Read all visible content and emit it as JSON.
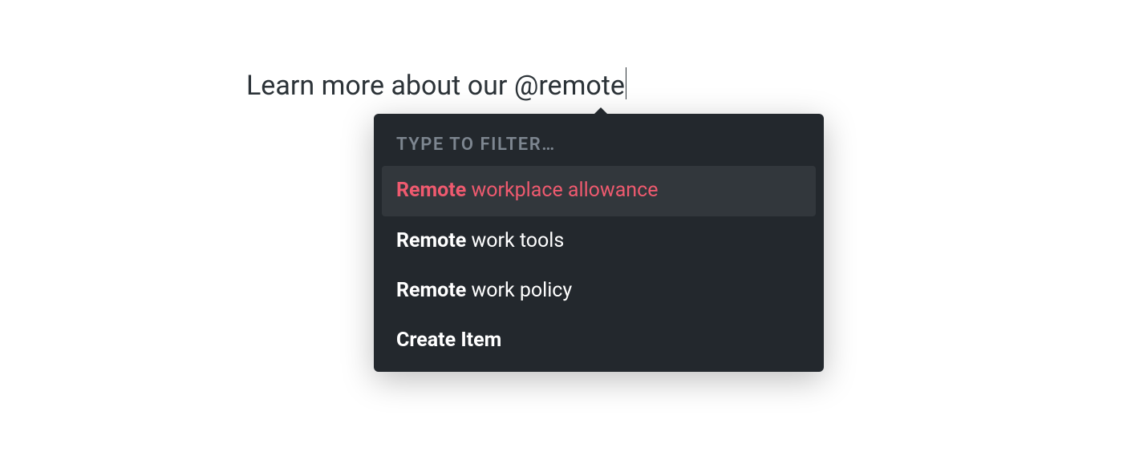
{
  "editor": {
    "text_before": "Learn more about our ",
    "mention_trigger": "@remote"
  },
  "dropdown": {
    "filter_label": "TYPE TO FILTER…",
    "suggestions": [
      {
        "match": "Remote",
        "rest": " workplace allowance",
        "selected": true
      },
      {
        "match": "Remote",
        "rest": " work tools",
        "selected": false
      },
      {
        "match": "Remote",
        "rest": " work policy",
        "selected": false
      }
    ],
    "create_label": "Create Item"
  }
}
